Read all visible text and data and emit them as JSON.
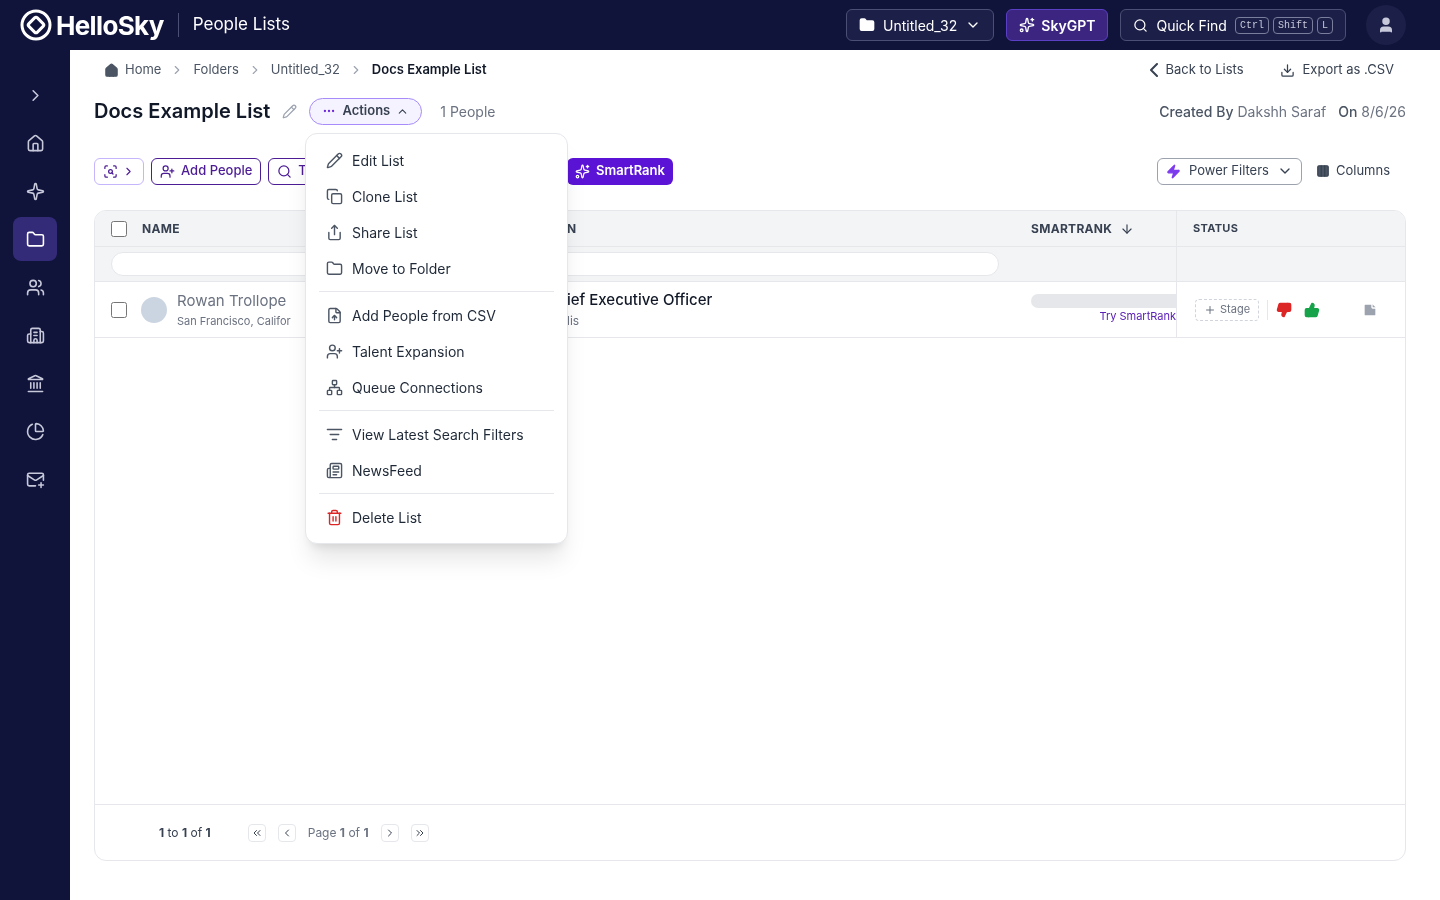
{
  "header": {
    "logo": "HelloSky",
    "section": "People Lists",
    "folder_select": "Untitled_32",
    "skygpt": "SkyGPT",
    "quick_find": {
      "label": "Quick Find",
      "keys": [
        "Ctrl",
        "Shift",
        "L"
      ]
    }
  },
  "sidebar": {
    "items": [
      {
        "kind": "expand",
        "selected": false
      },
      {
        "kind": "home",
        "selected": false
      },
      {
        "kind": "sparkle",
        "selected": false
      },
      {
        "kind": "folder",
        "selected": true
      },
      {
        "kind": "people",
        "selected": false
      },
      {
        "kind": "building",
        "selected": false
      },
      {
        "kind": "bank",
        "selected": false
      },
      {
        "kind": "chart",
        "selected": false
      },
      {
        "kind": "mail",
        "selected": false
      }
    ]
  },
  "breadcrumbs": [
    "Home",
    "Folders",
    "Untitled_32",
    "Docs Example List"
  ],
  "top_links": [
    {
      "kind": "back",
      "label": "Back to Lists"
    },
    {
      "kind": "export",
      "label": "Export as .CSV"
    }
  ],
  "title": "Docs Example List",
  "actions_button": {
    "label": "Actions",
    "expanded": true
  },
  "people_count": "1 People",
  "created": {
    "label": "Created By",
    "name": "Dakshh Saraf",
    "on_label": "On",
    "date": "8/6/26"
  },
  "toolbar": {
    "buttons": [
      {
        "kind": "filter"
      },
      {
        "kind": "add",
        "label": "Add People"
      },
      {
        "kind": "search",
        "label": "T"
      },
      {
        "kind": "smartrank",
        "label": "SmartRank"
      }
    ],
    "power_filters": "Power Filters",
    "columns": "Columns"
  },
  "table": {
    "select_all_checked": false,
    "columns": [
      "NAME",
      "N",
      "SMARTRANK",
      "STATUS"
    ],
    "rows": [
      {
        "checked": false,
        "name": "Rowan Trollope",
        "location": "San Francisco, Califor",
        "title": "ief Executive Officer",
        "company": "lis",
        "smartrank_link": "Try SmartRank",
        "stage": "Stage"
      }
    ]
  },
  "pagination": {
    "range": "**1** to **1** of **1**",
    "page": "Page **1** of **1**"
  },
  "menu": {
    "groups": [
      [
        {
          "kind": "edit",
          "label": "Edit List"
        },
        {
          "kind": "clone",
          "label": "Clone List"
        },
        {
          "kind": "share",
          "label": "Share List"
        },
        {
          "kind": "move",
          "label": "Move to Folder"
        }
      ],
      [
        {
          "kind": "csv",
          "label": "Add People from CSV"
        },
        {
          "kind": "expansion",
          "label": "Talent Expansion"
        },
        {
          "kind": "queue",
          "label": "Queue Connections"
        }
      ],
      [
        {
          "kind": "filters",
          "label": "View Latest Search Filters"
        },
        {
          "kind": "news",
          "label": "NewsFeed"
        }
      ],
      [
        {
          "kind": "delete",
          "label": "Delete List"
        }
      ]
    ]
  }
}
